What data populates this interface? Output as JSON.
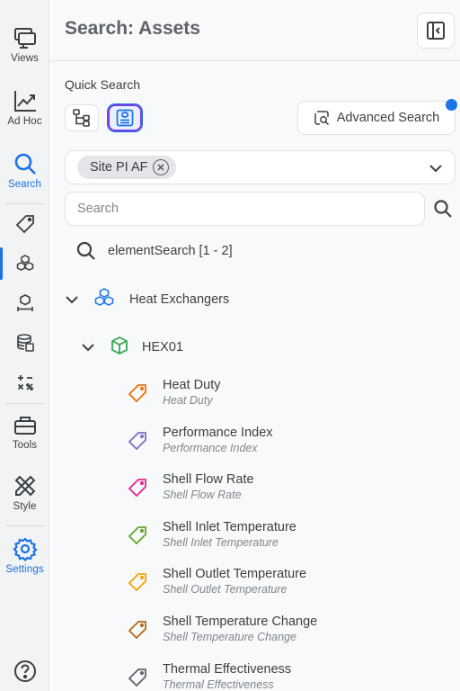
{
  "rail": {
    "views_label": "Views",
    "adhoc_label": "Ad Hoc",
    "search_label": "Search",
    "tools_label": "Tools",
    "style_label": "Style",
    "settings_label": "Settings",
    "sub_items": [
      "tag-icon",
      "assets-icon",
      "event-frames-icon",
      "database-icon",
      "calculation-icon"
    ],
    "accent": "#1a73e8"
  },
  "header": {
    "title": "Search: Assets"
  },
  "quick_search": {
    "label": "Quick Search",
    "buttons": [
      "hierarchy-icon",
      "asset-search-icon"
    ]
  },
  "advanced": {
    "label": "Advanced Search"
  },
  "source": {
    "chip": "Site PI AF"
  },
  "search": {
    "placeholder": "Search"
  },
  "results": {
    "query": "elementSearch [1 - 2]",
    "group": "Heat Exchangers",
    "element": "HEX01",
    "attributes": [
      {
        "name": "Heat Duty",
        "sub": "Heat Duty",
        "color": "#e8710a"
      },
      {
        "name": "Performance Index",
        "sub": "Performance Index",
        "color": "#7b6fc4"
      },
      {
        "name": "Shell Flow Rate",
        "sub": "Shell Flow Rate",
        "color": "#e52592"
      },
      {
        "name": "Shell Inlet Temperature",
        "sub": "Shell Inlet Temperature",
        "color": "#5fa82b"
      },
      {
        "name": "Shell Outlet Temperature",
        "sub": "Shell Outlet Temperature",
        "color": "#f2a600"
      },
      {
        "name": "Shell Temperature Change",
        "sub": "Shell Temperature Change",
        "color": "#b06a1a"
      },
      {
        "name": "Thermal Effectiveness",
        "sub": "Thermal Effectiveness",
        "color": "#5f6368"
      }
    ]
  }
}
